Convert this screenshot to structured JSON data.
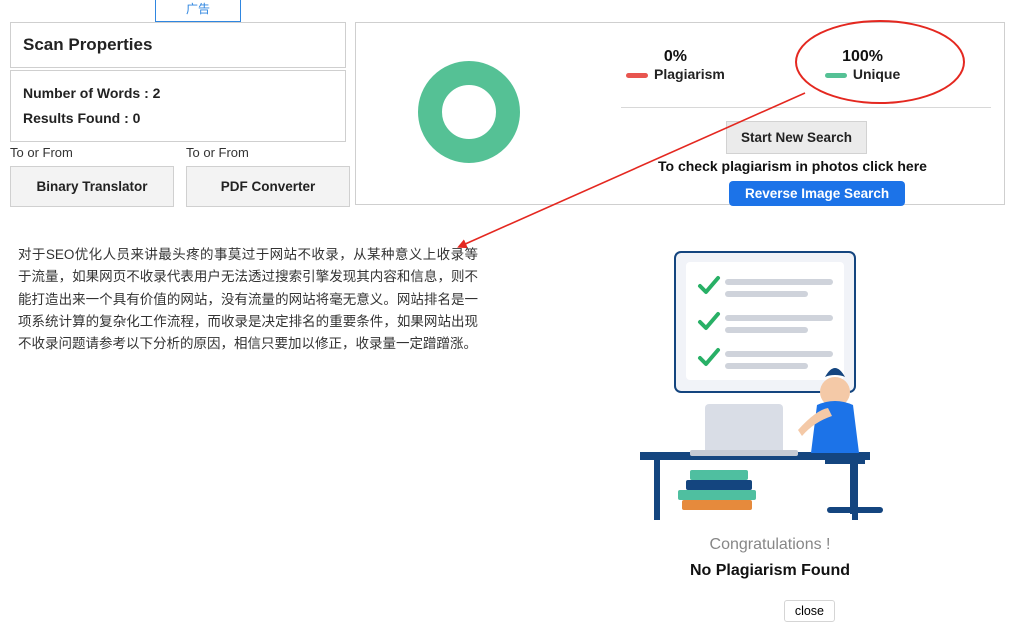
{
  "chart_data": {
    "type": "pie",
    "title": "",
    "series": [
      {
        "name": "Plagiarism",
        "value": 0,
        "color": "#e8554f"
      },
      {
        "name": "Unique",
        "value": 100,
        "color": "#55c195"
      }
    ]
  },
  "top_tab": "广告",
  "scan": {
    "title": "Scan Properties",
    "words_label": "Number of Words : ",
    "words_value": "2",
    "results_label": "Results Found : ",
    "results_value": "0"
  },
  "tools": {
    "label": "To or From",
    "binary": "Binary Translator",
    "pdf": "PDF Converter"
  },
  "result": {
    "plag_pct": "0%",
    "plag_label": "Plagiarism",
    "uniq_pct": "100%",
    "uniq_label": "Unique",
    "start_new": "Start New Search",
    "check_photos": "To check plagiarism in photos click here",
    "reverse": "Reverse Image Search"
  },
  "content_text": "对于SEO优化人员来讲最头疼的事莫过于网站不收录，从某种意义上收录等于流量，如果网页不收录代表用户无法透过搜索引擎发现其内容和信息，则不能打造出来一个具有价值的网站，没有流量的网站将毫无意义。网站排名是一项系统计算的复杂化工作流程，而收录是决定排名的重要条件，如果网站出现不收录问题请参考以下分析的原因，相信只要加以修正，收录量一定蹭蹭涨。",
  "congrats": {
    "title": "Congratulations !",
    "subtitle": "No Plagiarism Found",
    "close": "close"
  }
}
